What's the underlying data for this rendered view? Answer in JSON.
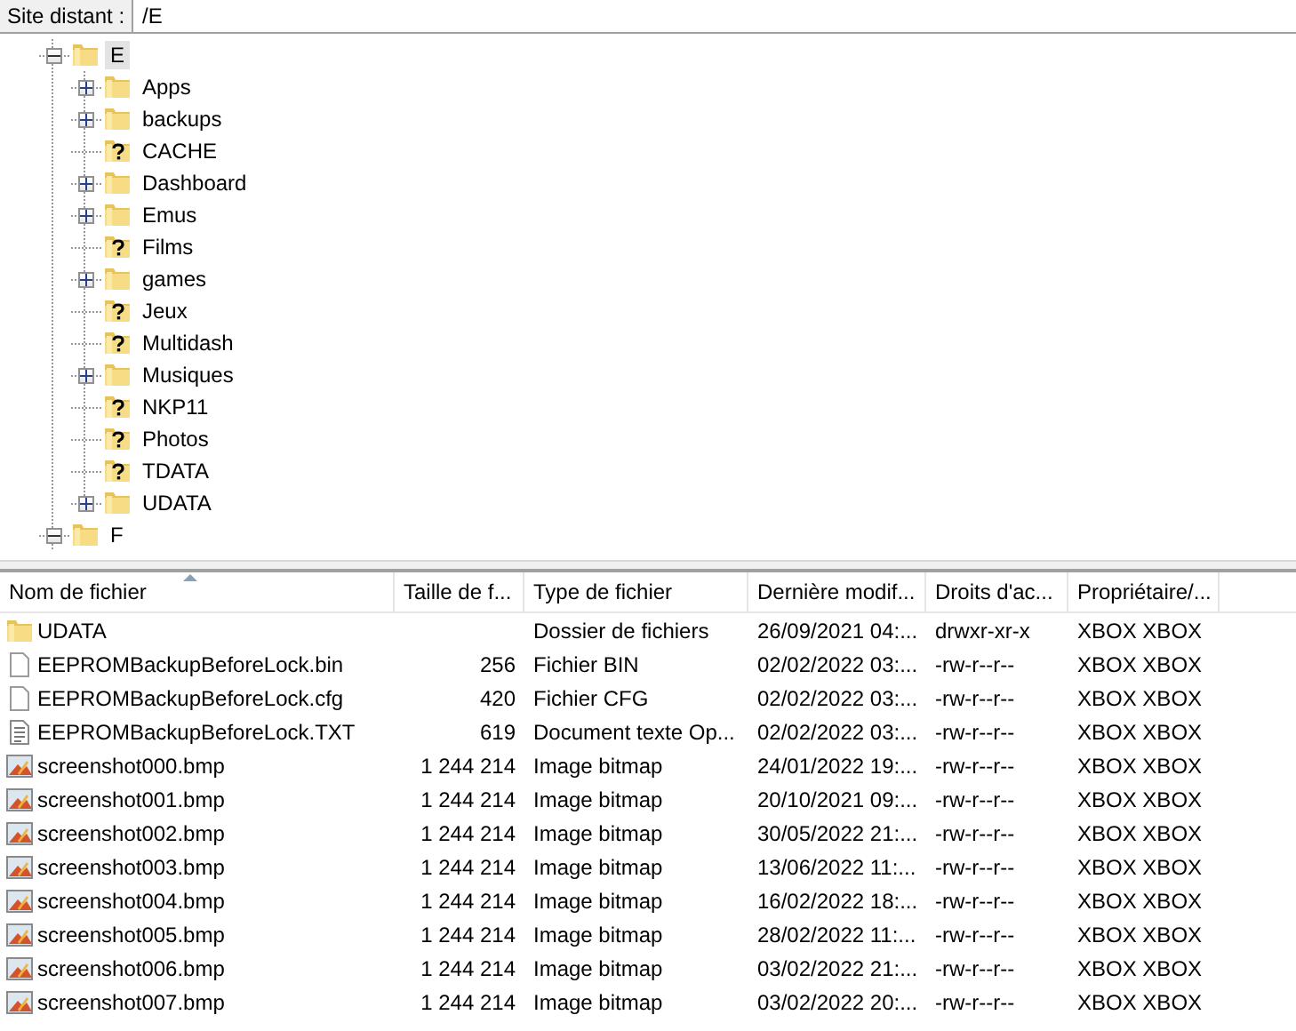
{
  "remote_site": {
    "label": "Site distant :",
    "path": "/E"
  },
  "tree": [
    {
      "label": "E",
      "kind": "folder",
      "expanded": true,
      "selected": true,
      "children": [
        {
          "label": "Apps",
          "kind": "folder",
          "expanded": false,
          "selected": false
        },
        {
          "label": "backups",
          "kind": "folder",
          "expanded": false,
          "selected": false
        },
        {
          "label": "CACHE",
          "kind": "unknown",
          "selected": false
        },
        {
          "label": "Dashboard",
          "kind": "folder",
          "expanded": false,
          "selected": false
        },
        {
          "label": "Emus",
          "kind": "folder",
          "expanded": false,
          "selected": false
        },
        {
          "label": "Films",
          "kind": "unknown",
          "selected": false
        },
        {
          "label": "games",
          "kind": "folder",
          "expanded": false,
          "selected": false
        },
        {
          "label": "Jeux",
          "kind": "unknown",
          "selected": false
        },
        {
          "label": "Multidash",
          "kind": "unknown",
          "selected": false
        },
        {
          "label": "Musiques",
          "kind": "folder",
          "expanded": false,
          "selected": false
        },
        {
          "label": "NKP11",
          "kind": "unknown",
          "selected": false
        },
        {
          "label": "Photos",
          "kind": "unknown",
          "selected": false
        },
        {
          "label": "TDATA",
          "kind": "unknown",
          "selected": false
        },
        {
          "label": "UDATA",
          "kind": "folder",
          "expanded": false,
          "selected": false
        }
      ]
    },
    {
      "label": "F",
      "kind": "folder",
      "expanded": true,
      "selected": false
    }
  ],
  "file_list": {
    "columns": [
      {
        "label": "Nom de fichier",
        "sorted": true
      },
      {
        "label": "Taille de f...",
        "sorted": false
      },
      {
        "label": "Type de fichier",
        "sorted": false
      },
      {
        "label": "Dernière modif...",
        "sorted": false
      },
      {
        "label": "Droits d'ac...",
        "sorted": false
      },
      {
        "label": "Propriétaire/...",
        "sorted": false
      }
    ],
    "rows": [
      {
        "kind": "folder",
        "name": "UDATA",
        "size": "",
        "type": "Dossier de fichiers",
        "modified": "26/09/2021 04:...",
        "permissions": "drwxr-xr-x",
        "owner": "XBOX XBOX"
      },
      {
        "kind": "file",
        "name": "EEPROMBackupBeforeLock.bin",
        "size": "256",
        "type": "Fichier BIN",
        "modified": "02/02/2022 03:...",
        "permissions": "-rw-r--r--",
        "owner": "XBOX XBOX"
      },
      {
        "kind": "file",
        "name": "EEPROMBackupBeforeLock.cfg",
        "size": "420",
        "type": "Fichier CFG",
        "modified": "02/02/2022 03:...",
        "permissions": "-rw-r--r--",
        "owner": "XBOX XBOX"
      },
      {
        "kind": "text",
        "name": "EEPROMBackupBeforeLock.TXT",
        "size": "619",
        "type": "Document texte Op...",
        "modified": "02/02/2022 03:...",
        "permissions": "-rw-r--r--",
        "owner": "XBOX XBOX"
      },
      {
        "kind": "image",
        "name": "screenshot000.bmp",
        "size": "1 244 214",
        "type": "Image bitmap",
        "modified": "24/01/2022 19:...",
        "permissions": "-rw-r--r--",
        "owner": "XBOX XBOX"
      },
      {
        "kind": "image",
        "name": "screenshot001.bmp",
        "size": "1 244 214",
        "type": "Image bitmap",
        "modified": "20/10/2021 09:...",
        "permissions": "-rw-r--r--",
        "owner": "XBOX XBOX"
      },
      {
        "kind": "image",
        "name": "screenshot002.bmp",
        "size": "1 244 214",
        "type": "Image bitmap",
        "modified": "30/05/2022 21:...",
        "permissions": "-rw-r--r--",
        "owner": "XBOX XBOX"
      },
      {
        "kind": "image",
        "name": "screenshot003.bmp",
        "size": "1 244 214",
        "type": "Image bitmap",
        "modified": "13/06/2022 11:...",
        "permissions": "-rw-r--r--",
        "owner": "XBOX XBOX"
      },
      {
        "kind": "image",
        "name": "screenshot004.bmp",
        "size": "1 244 214",
        "type": "Image bitmap",
        "modified": "16/02/2022 18:...",
        "permissions": "-rw-r--r--",
        "owner": "XBOX XBOX"
      },
      {
        "kind": "image",
        "name": "screenshot005.bmp",
        "size": "1 244 214",
        "type": "Image bitmap",
        "modified": "28/02/2022 11:...",
        "permissions": "-rw-r--r--",
        "owner": "XBOX XBOX"
      },
      {
        "kind": "image",
        "name": "screenshot006.bmp",
        "size": "1 244 214",
        "type": "Image bitmap",
        "modified": "03/02/2022 21:...",
        "permissions": "-rw-r--r--",
        "owner": "XBOX XBOX"
      },
      {
        "kind": "image",
        "name": "screenshot007.bmp",
        "size": "1 244 214",
        "type": "Image bitmap",
        "modified": "03/02/2022 20:...",
        "permissions": "-rw-r--r--",
        "owner": "XBOX XBOX"
      }
    ]
  }
}
